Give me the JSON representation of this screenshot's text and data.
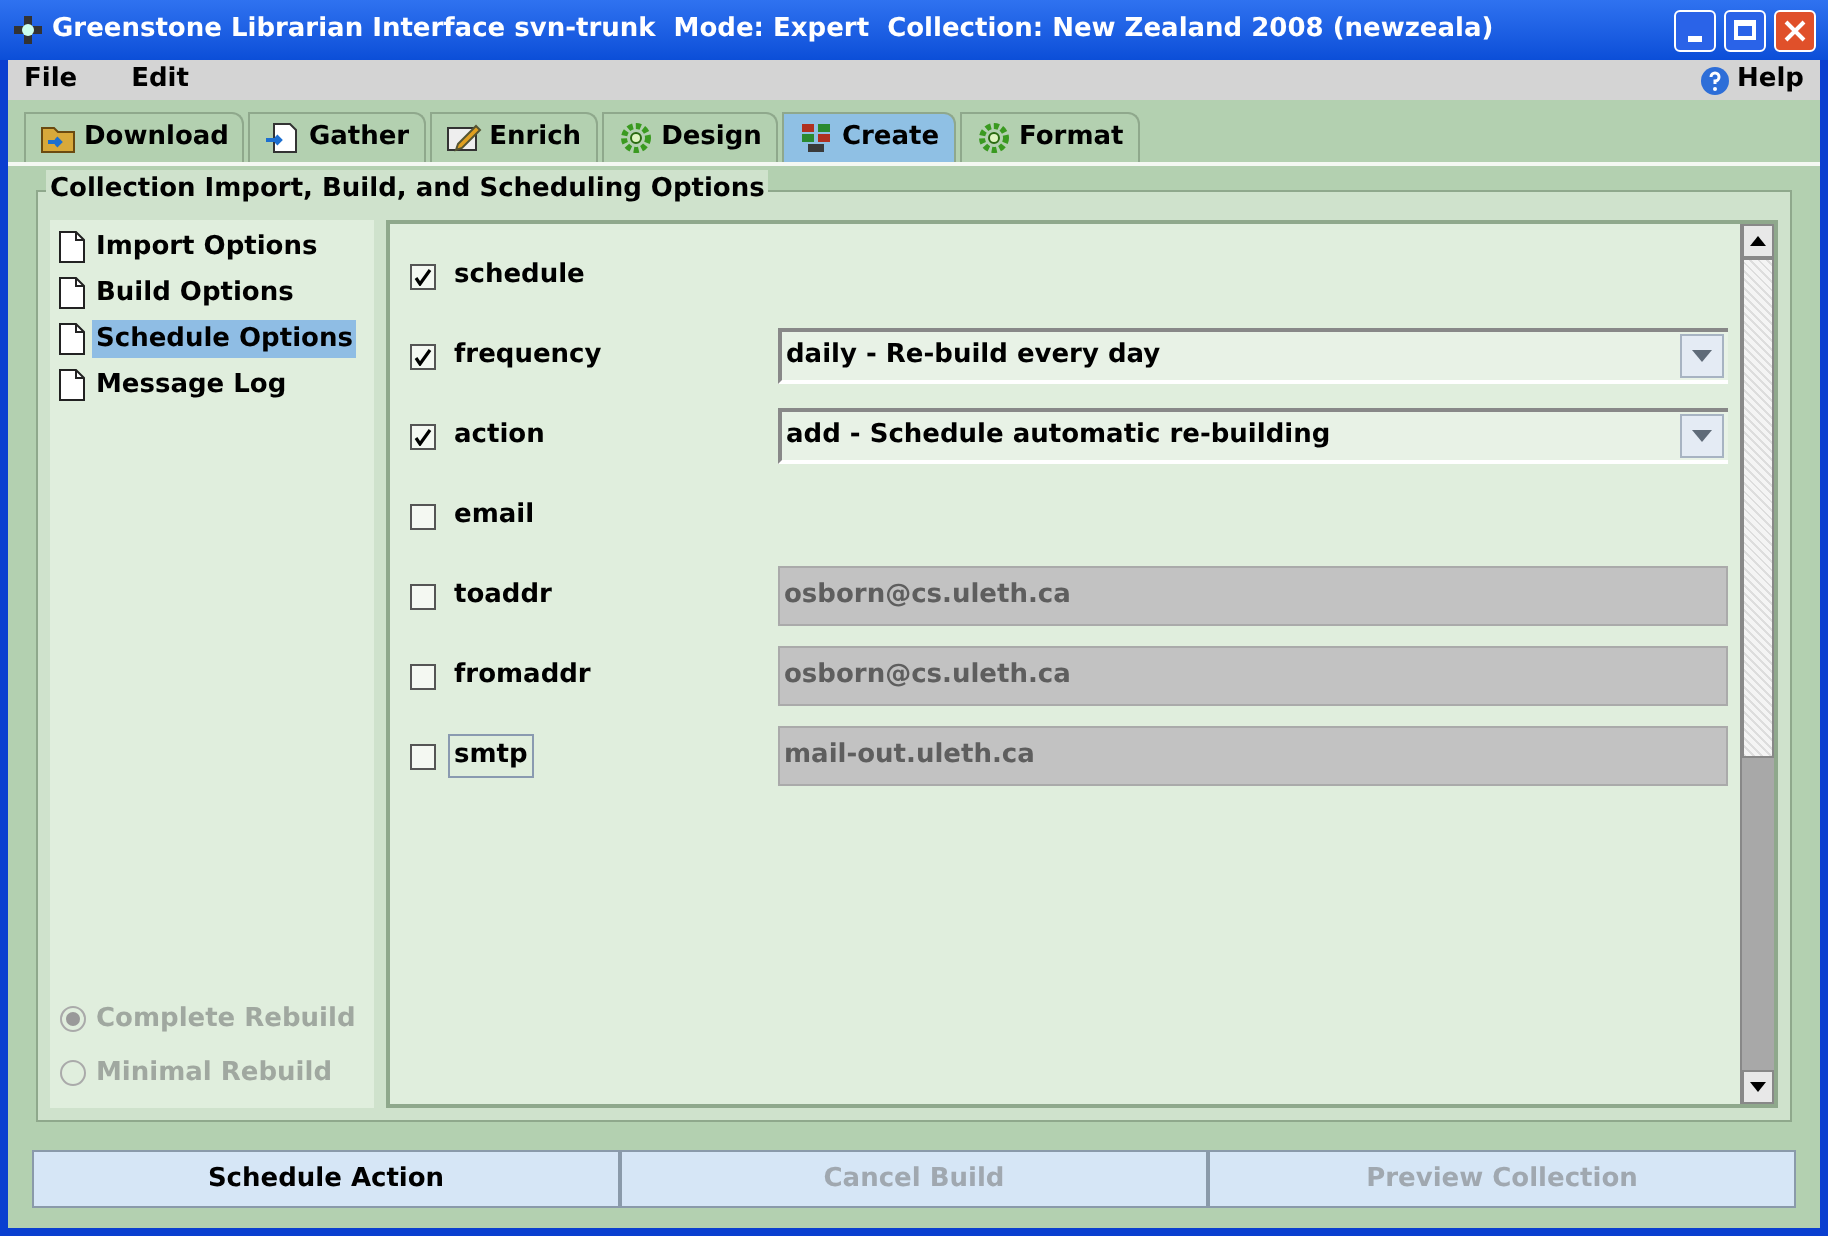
{
  "window": {
    "title": "Greenstone Librarian Interface svn-trunk  Mode: Expert  Collection: New Zealand 2008 (newzeala)"
  },
  "menu": [
    "File",
    "Edit"
  ],
  "help": "Help",
  "tabs": [
    {
      "label": "Download",
      "selected": false
    },
    {
      "label": "Gather",
      "selected": false
    },
    {
      "label": "Enrich",
      "selected": false
    },
    {
      "label": "Design",
      "selected": false
    },
    {
      "label": "Create",
      "selected": true
    },
    {
      "label": "Format",
      "selected": false
    }
  ],
  "group_title": "Collection Import, Build, and Scheduling Options",
  "sidebar": {
    "items": [
      {
        "label": "Import Options",
        "selected": false
      },
      {
        "label": "Build Options",
        "selected": false
      },
      {
        "label": "Schedule Options",
        "selected": true
      },
      {
        "label": "Message Log",
        "selected": false
      }
    ],
    "rebuild": [
      {
        "label": "Complete Rebuild",
        "selected": true,
        "disabled": true
      },
      {
        "label": "Minimal Rebuild",
        "selected": false,
        "disabled": true
      }
    ]
  },
  "options": [
    {
      "kind": "flag",
      "label": "schedule",
      "checked": true,
      "focused": false
    },
    {
      "kind": "dropdown",
      "label": "frequency",
      "checked": true,
      "focused": false,
      "value": "daily - Re-build every day"
    },
    {
      "kind": "dropdown",
      "label": "action",
      "checked": true,
      "focused": false,
      "value": "add - Schedule automatic re-building"
    },
    {
      "kind": "flag",
      "label": "email",
      "checked": false,
      "focused": false
    },
    {
      "kind": "text",
      "label": "toaddr",
      "checked": false,
      "focused": false,
      "value": "osborn@cs.uleth.ca",
      "disabled": true
    },
    {
      "kind": "text",
      "label": "fromaddr",
      "checked": false,
      "focused": false,
      "value": "osborn@cs.uleth.ca",
      "disabled": true
    },
    {
      "kind": "text",
      "label": "smtp",
      "checked": false,
      "focused": true,
      "value": "mail-out.uleth.ca",
      "disabled": true
    }
  ],
  "buttons": [
    {
      "label": "Schedule Action",
      "disabled": false
    },
    {
      "label": "Cancel Build",
      "disabled": true
    },
    {
      "label": "Preview Collection",
      "disabled": true
    }
  ]
}
